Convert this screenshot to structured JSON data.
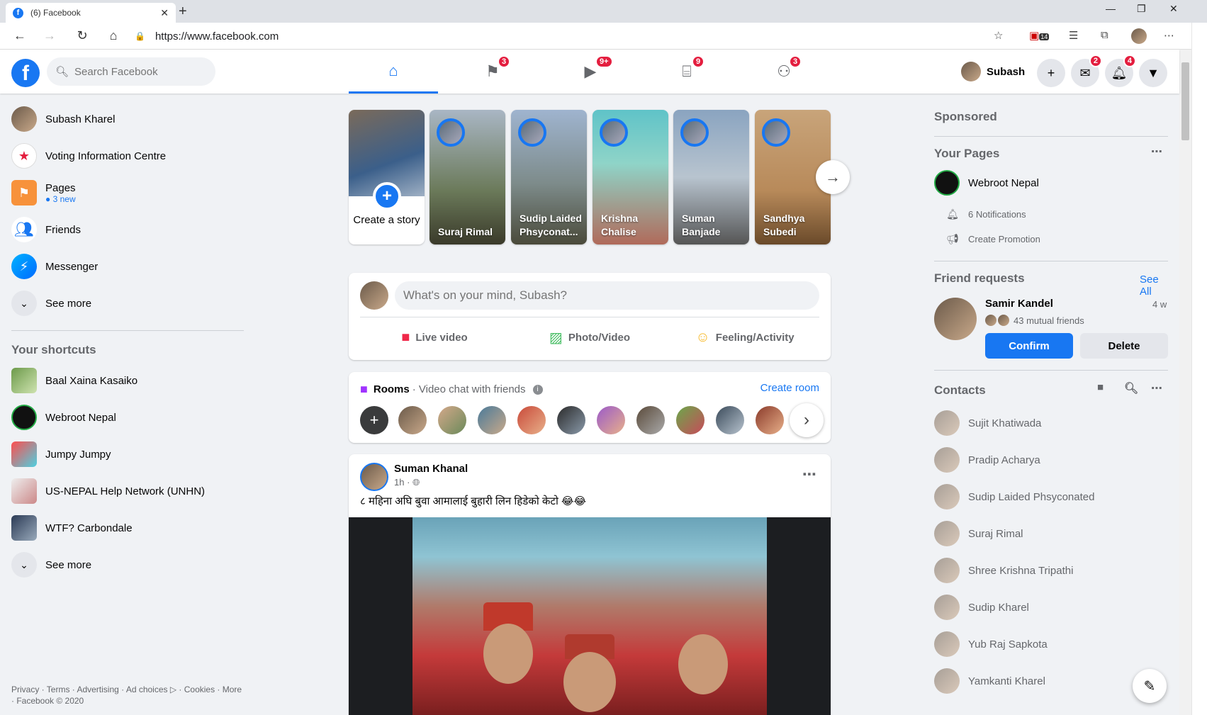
{
  "browser": {
    "tab_title": "(6) Facebook",
    "url": "https://www.facebook.com",
    "ext_badge": "14"
  },
  "header": {
    "search_placeholder": "Search Facebook",
    "nav": [
      {
        "name": "home",
        "badge": ""
      },
      {
        "name": "pages",
        "badge": "3"
      },
      {
        "name": "watch",
        "badge": "9+"
      },
      {
        "name": "marketplace",
        "badge": "9"
      },
      {
        "name": "groups",
        "badge": "3"
      }
    ],
    "profile_name": "Subash",
    "messenger_badge": "2",
    "notifications_badge": "4"
  },
  "left": {
    "items": [
      {
        "label": "Subash Kharel"
      },
      {
        "label": "Voting Information Centre"
      },
      {
        "label": "Pages",
        "sub": "● 3 new"
      },
      {
        "label": "Friends"
      },
      {
        "label": "Messenger"
      },
      {
        "label": "See more"
      }
    ],
    "shortcuts_title": "Your shortcuts",
    "shortcuts": [
      {
        "label": "Baal Xaina Kasaiko"
      },
      {
        "label": "Webroot Nepal"
      },
      {
        "label": "Jumpy Jumpy"
      },
      {
        "label": "US-NEPAL Help Network (UNHN)"
      },
      {
        "label": "WTF? Carbondale"
      },
      {
        "label": "See more"
      }
    ],
    "footer": "Privacy · Terms · Advertising · Ad choices ▷ · Cookies · More · Facebook © 2020"
  },
  "stories": {
    "create_label": "Create a story",
    "items": [
      {
        "name": "Suraj Rimal"
      },
      {
        "name": "Sudip Laided Phsyconat..."
      },
      {
        "name": "Krishna Chalise"
      },
      {
        "name": "Suman Banjade"
      },
      {
        "name": "Sandhya Subedi"
      }
    ]
  },
  "composer": {
    "placeholder": "What's on your mind, Subash?",
    "live": "Live video",
    "photo": "Photo/Video",
    "feeling": "Feeling/Activity"
  },
  "rooms": {
    "title": "Rooms",
    "subtitle": "· Video chat with friends",
    "create": "Create room"
  },
  "post": {
    "author": "Suman Khanal",
    "time": "1h ·",
    "text": "८ महिना अघि बुवा आमालाई बुहारी लिन हिडेको केटो 😂😂"
  },
  "right": {
    "sponsored": "Sponsored",
    "your_pages": "Your Pages",
    "page_name": "Webroot Nepal",
    "notifications": "6 Notifications",
    "create_promotion": "Create Promotion",
    "friend_requests": "Friend requests",
    "see_all": "See All",
    "requester": "Samir Kandel",
    "request_time": "4 w",
    "mutual": "43 mutual friends",
    "confirm": "Confirm",
    "delete": "Delete",
    "contacts_title": "Contacts",
    "contacts": [
      "Sujit Khatiwada",
      "Pradip Acharya",
      "Sudip Laided Phsyconated",
      "Suraj Rimal",
      "Shree Krishna Tripathi",
      "Sudip Kharel",
      "Yub Raj Sapkota",
      "Yamkanti Kharel"
    ]
  },
  "colors": {
    "accent": "#1877f2",
    "badge": "#e41e3f",
    "bg": "#f0f2f5"
  }
}
